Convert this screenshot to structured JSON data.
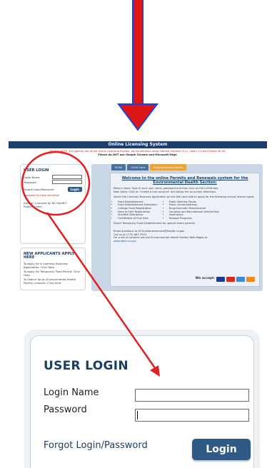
{
  "colors": {
    "accent": "#e02020",
    "brand": "#1a3f66",
    "button": "#2f5a86",
    "title_bar": "#1c3d6e"
  },
  "header": {
    "title": "Online Licensing System"
  },
  "notice": {
    "line1": "PLEASE NOTE: For optimal use of the Online Licensing System, we recommend using Internet Explorer 9-11, Safari 5.0 and Firefox 3x-40.",
    "line2": "Please do NOT use Google Chrome and Microsoft Edge."
  },
  "mini_login": {
    "title": "USER LOGIN",
    "login_name_label": "Login Name",
    "password_label": "Password",
    "forgot": "Forgot Login/Password",
    "button": "Login",
    "red_text": "Password is case sensitive",
    "already_text": "Already Licensed by NV Health?",
    "register": "Register Here"
  },
  "mini_new": {
    "title": "NEW APPLICANTS APPLY HERE",
    "item1": "To apply for a Common Business Application: Click Here",
    "item2": "To apply for Temporary Food Permit: Click Here",
    "item3": "To Search for an Environmental Health Facility Licenses: Click Here"
  },
  "tabs": [
    "RC&E",
    "Child Care",
    "Environmental Health"
  ],
  "welcome": {
    "heading": "Welcome to the online Permits and Renewals system for the Environmental Health Section:",
    "returning": "Return Users: Type in your user name, password and then click on the LOGIN box.",
    "new_users": "New Users: Click on \"create a new account\" and follow the on-screen directions.",
    "select_text": "Select the Common Business Application on the left hand side to apply for the following annual license types:",
    "types_left": [
      "Food Establishment",
      "Food Establishment Exemption",
      "Cottage Food Registration",
      "Farm to Fork Registration",
      "Shellfish Distributor",
      "Certificates of Free Sale"
    ],
    "types_right": [
      "Public Bathing Places",
      "Public Accomodations",
      "Drug/Cosmetic Manufacturer",
      "Camping and Recreational Vehicle Park",
      "Institutions",
      "Sewage Programs"
    ],
    "temp_text": "Select Temporary Food Establishment for special event permits.",
    "email_text": "Email questions to OLScustomerservice@health.nv.gov",
    "call_text": "Call us at (775) 687-7533",
    "contacts_text": "For a list of contacts see the Environmental Health Section Web Pages at",
    "site": "www.dpbh.nv.gov",
    "accept": "We accept:"
  },
  "cards": [
    {
      "name": "visa-icon",
      "color": "#1a3c8e"
    },
    {
      "name": "mastercard-icon",
      "color": "#d92b1c"
    },
    {
      "name": "amex-icon",
      "color": "#3f8ad6"
    },
    {
      "name": "discover-icon",
      "color": "#f08a1c"
    }
  ],
  "zoom": {
    "title": "USER LOGIN",
    "login_name_label": "Login Name",
    "password_label": "Password",
    "forgot": "Forgot Login/Password",
    "button": "Login"
  }
}
